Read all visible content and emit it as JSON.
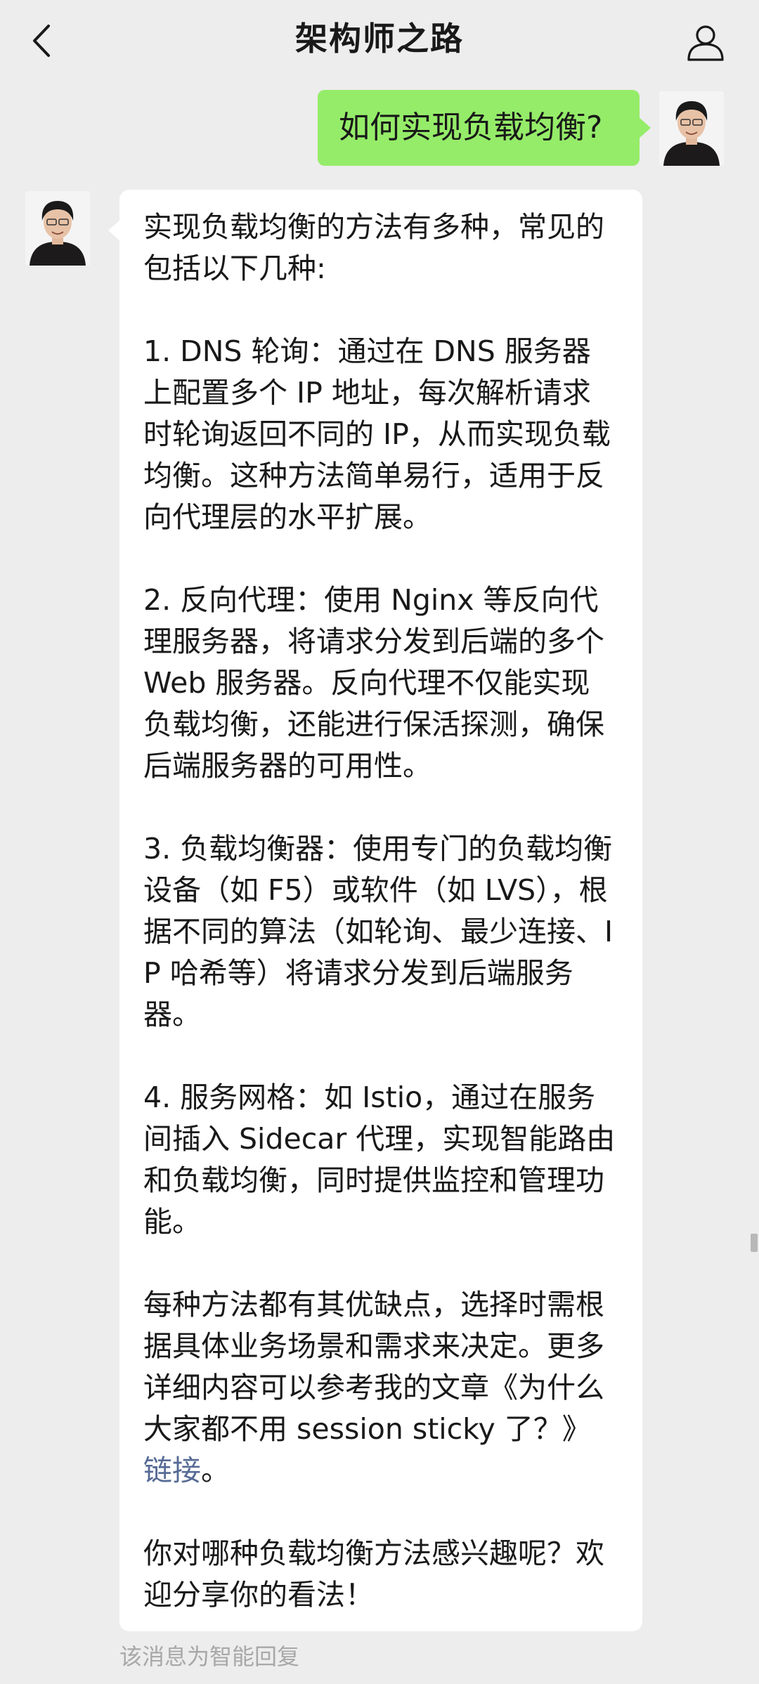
{
  "header": {
    "title": "架构师之路",
    "back_icon": "chevron-left-icon",
    "profile_icon": "person-icon"
  },
  "messages": {
    "outgoing": {
      "text": "如何实现负载均衡?"
    },
    "incoming": {
      "intro": "实现负载均衡的方法有多种，常见的包括以下几种:",
      "item1": "1. DNS 轮询：通过在 DNS 服务器上配置多个 IP 地址，每次解析请求时轮询返回不同的 IP，从而实现负载均衡。这种方法简单易行，适用于反向代理层的水平扩展。",
      "item2": "2. 反向代理：使用 Nginx 等反向代理服务器，将请求分发到后端的多个 Web 服务器。反向代理不仅能实现负载均衡，还能进行保活探测，确保后端服务器的可用性。",
      "item3": "3. 负载均衡器：使用专门的负载均衡设备（如 F5）或软件（如 LVS），根据不同的算法（如轮询、最少连接、IP 哈希等）将请求分发到后端服务器。",
      "item4": "4. 服务网格：如 Istio，通过在服务间插入 Sidecar 代理，实现智能路由和负载均衡，同时提供监控和管理功能。",
      "summary_prefix": "每种方法都有其优缺点，选择时需根据具体业务场景和需求来决定。更多详细内容可以参考我的文章《为什么大家都不用 session sticky 了？》",
      "link_text": "链接",
      "summary_suffix": "。",
      "closing": "你对哪种负载均衡方法感兴趣呢？欢迎分享你的看法！"
    },
    "footer_note": "该消息为智能回复"
  },
  "colors": {
    "background": "#ededed",
    "outgoing_bubble": "#95ec69",
    "incoming_bubble": "#ffffff",
    "link": "#576b95"
  }
}
